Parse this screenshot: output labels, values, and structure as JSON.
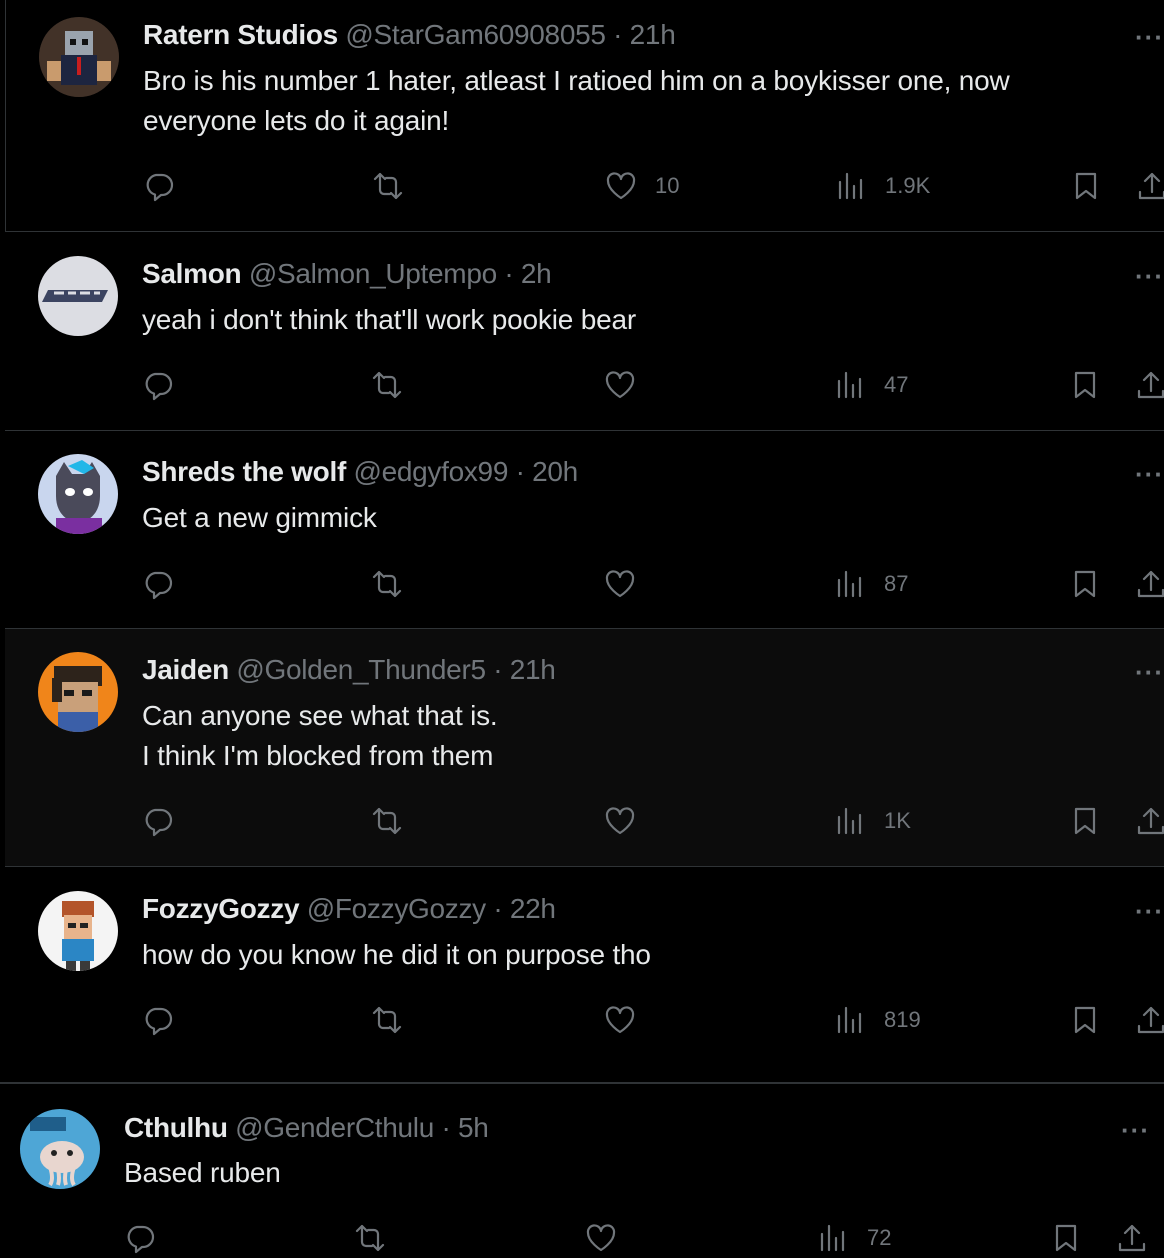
{
  "tweets": [
    {
      "name": "Ratern Studios",
      "handle": "@StarGam60908055",
      "time": "21h",
      "text": "Bro is his number 1 hater, atleast I ratioed him on a boykisser one, now\neveryone lets do it again!",
      "likes": "10",
      "views": "1.9K",
      "avatar_icon": "roblox-character-avatar"
    },
    {
      "name": "Salmon",
      "handle": "@Salmon_Uptempo",
      "time": "2h",
      "text": "yeah i don't think that'll work pookie bear",
      "likes": "",
      "views": "47",
      "avatar_icon": "logo-avatar"
    },
    {
      "name": "Shreds the wolf",
      "handle": "@edgyfox99",
      "time": "20h",
      "text": "Get a new gimmick",
      "likes": "",
      "views": "87",
      "avatar_icon": "wolf-character-avatar"
    },
    {
      "name": "Jaiden",
      "handle": "@Golden_Thunder5",
      "time": "21h",
      "text": "Can anyone see what that is.\nI think I'm blocked from them",
      "likes": "",
      "views": "1K",
      "avatar_icon": "pixel-character-avatar"
    },
    {
      "name": "FozzyGozzy",
      "handle": "@FozzyGozzy",
      "time": "22h",
      "text": "how do you know he did it on purpose tho",
      "likes": "",
      "views": "819",
      "avatar_icon": "cartoon-character-avatar"
    },
    {
      "name": "Cthulhu",
      "handle": "@GenderCthulu",
      "time": "5h",
      "text": "Based ruben",
      "likes": "",
      "views": "72",
      "avatar_icon": "cthulhu-avatar"
    }
  ],
  "more_label": "···",
  "colors": {
    "background": "#000000",
    "text": "#e7e9ea",
    "muted": "#71767b",
    "border": "#2f3336"
  }
}
